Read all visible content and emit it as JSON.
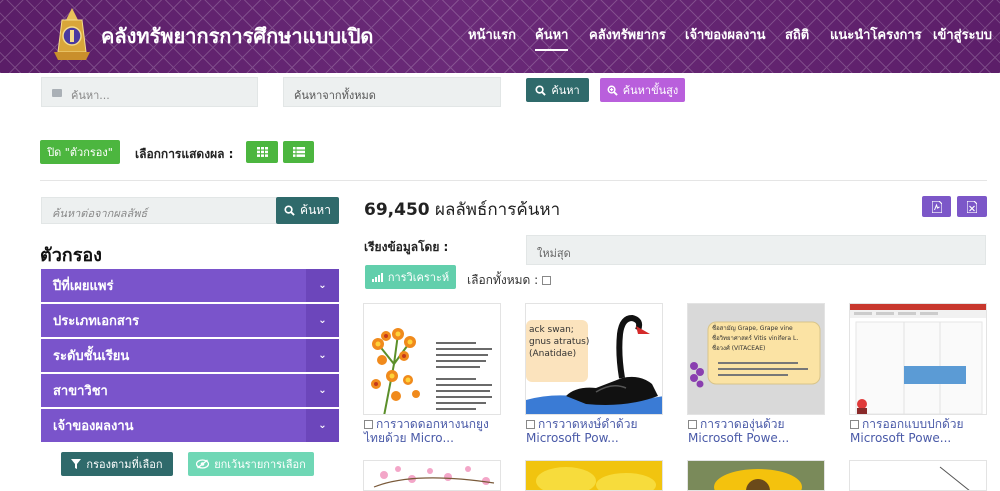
{
  "header": {
    "site_title": "คลังทรัพยากรการศึกษาแบบเปิด",
    "nav": [
      "หน้าแรก",
      "ค้นหา",
      "คลังทรัพยากร",
      "เจ้าของผลงาน",
      "สถิติ",
      "แนะนำโครงการ",
      "เข้าสู่ระบบ"
    ],
    "active_nav": "ค้นหา"
  },
  "search": {
    "query_placeholder": "ค้นหา...",
    "scope_value": "ค้นหาจากทั้งหมด",
    "search_label": "ค้นหา",
    "advanced_label": "ค้นหาขั้นสูง"
  },
  "toolbar": {
    "toggle_filter_label": "ปิด \"ตัวกรอง\"",
    "display_mode_label": "เลือกการแสดงผล :"
  },
  "sidebar": {
    "refine_placeholder": "ค้นหาต่อจากผลลัพธ์",
    "refine_button": "ค้นหา",
    "title": "ตัวกรอง",
    "filters": [
      "ปีที่เผยแพร่",
      "ประเภทเอกสาร",
      "ระดับชั้นเรียน",
      "สาขาวิชา",
      "เจ้าของผลงาน"
    ],
    "apply_button": "กรองตามที่เลือก",
    "clear_button": "ยกเว้นรายการเลือก"
  },
  "results": {
    "count": "69,450",
    "count_label": "ผลลัพธ์การค้นหา",
    "sort_label": "เรียงข้อมูลโดย :",
    "sort_value": "ใหม่สุด",
    "analyze_button": "การวิเคราะห์",
    "select_all_label": "เลือกทั้งหมด :",
    "items": [
      {
        "title_line1": "การวาดดอกหางนกยูง",
        "title_line2": "ไทยด้วย Micro..."
      },
      {
        "title_line1": "การวาดหงษ์ดำด้วย",
        "title_line2": "Microsoft Pow..."
      },
      {
        "title_line1": "การวาดองุ่นด้วย",
        "title_line2": "Microsoft Powe..."
      },
      {
        "title_line1": "การออกแบบปกด้วย",
        "title_line2": "Microsoft Powe..."
      }
    ],
    "thumb_text": {
      "swan_line1": "ack swan;",
      "swan_line2": "gnus atratus)",
      "swan_line3": "(Anatidae)",
      "grape_line1": "ชื่อสามัญ Grape, Grape vine",
      "grape_line2": "ชื่อวิทยาศาสตร์ Vitis vinifera L.",
      "grape_line3": "ชื่อวงศ์ (VITACEAE)"
    }
  },
  "colors": {
    "header_bg": "#5a1d67",
    "filter_bg": "#7a54cb",
    "search_button": "#2f6a6b",
    "advanced_button": "#b95fdc",
    "green_button": "#4cb63f",
    "mint_button": "#6fd7b5",
    "link": "#4a5aa8"
  }
}
